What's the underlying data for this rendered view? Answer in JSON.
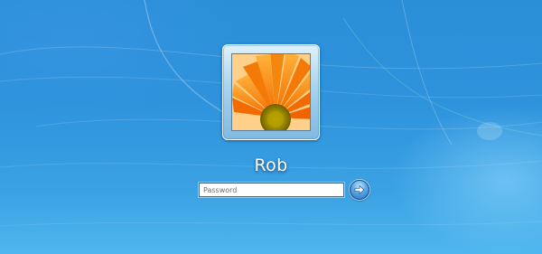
{
  "user": {
    "name": "Rob",
    "avatar_icon": "orange-gerbera-flower",
    "avatar_frame_color": "#a9d3ee"
  },
  "password_field": {
    "value": "",
    "placeholder": "Password"
  },
  "submit_button": {
    "icon": "arrow-right-icon",
    "color": "#1f6cc0"
  },
  "background": {
    "color": "#2e93dc"
  }
}
